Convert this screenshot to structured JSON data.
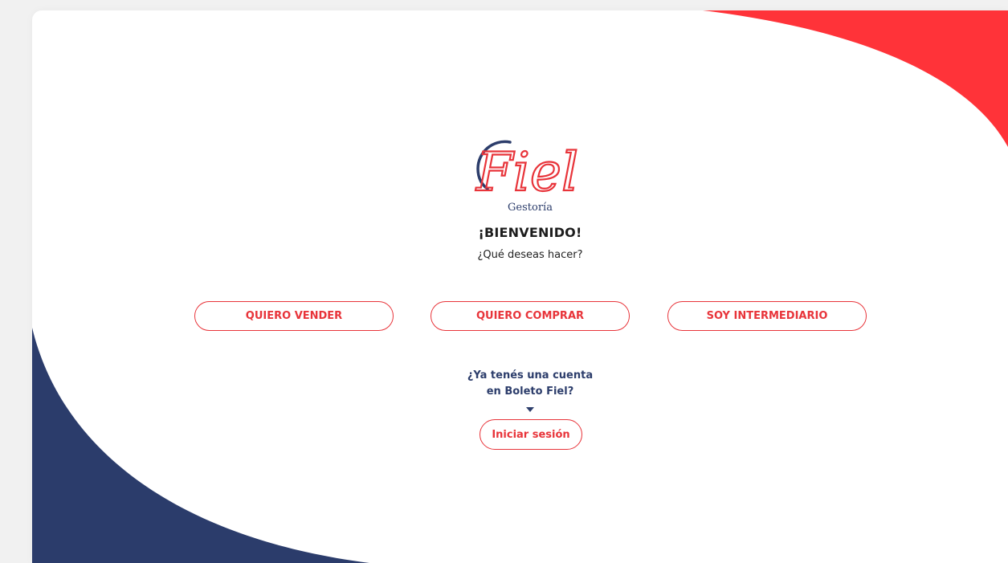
{
  "colors": {
    "brand_red": "#ff3339",
    "brand_navy": "#2b3c6b",
    "accent_red": "#e8343a",
    "background": "#f1f1f1",
    "card": "#ffffff"
  },
  "logo": {
    "script_text": "Fiel",
    "subtitle": "Gestoría"
  },
  "header": {
    "welcome": "¡BIENVENIDO!",
    "question": "¿Qué deseas hacer?"
  },
  "actions": {
    "sell": "QUIERO VENDER",
    "buy": "QUIERO COMPRAR",
    "intermediary": "SOY INTERMEDIARIO"
  },
  "account": {
    "question_line1": "¿Ya tenés una cuenta",
    "question_line2": "en Boleto Fiel?",
    "login_label": "Iniciar sesión",
    "caret_icon": "caret-down-icon"
  }
}
